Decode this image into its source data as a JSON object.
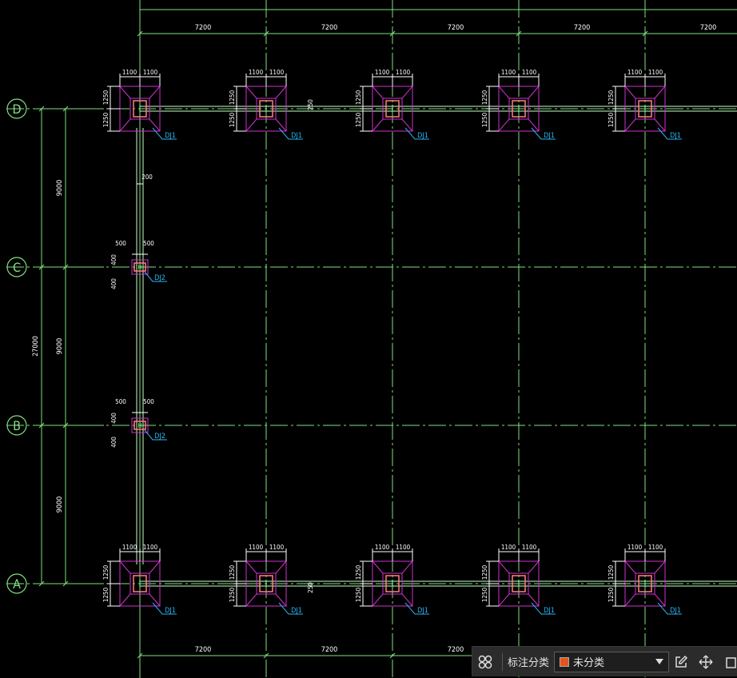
{
  "axes": {
    "rows": [
      "D",
      "C",
      "B",
      "A"
    ],
    "bay_top": "7200",
    "bay_bottom": "7200",
    "row_spacing": "9000",
    "total_depth": "27000"
  },
  "dims": {
    "half_width": "1100",
    "half_depth": "1250",
    "small_half_width": "500",
    "small_half_depth": "400",
    "wall_offset": "200",
    "beam_offset": "250"
  },
  "labels": {
    "big_footing": "DJ1",
    "small_footing": "DJ2"
  },
  "colors": {
    "grid": "#7fe07f",
    "dim": "#ffffff",
    "footing": "#d032d0",
    "column": "#ff8080",
    "label": "#29b6f6",
    "beam": "#c8ffc8"
  },
  "toolbar": {
    "label": "标注分类",
    "selected": "未分类",
    "selected_color": "#e5541c"
  }
}
